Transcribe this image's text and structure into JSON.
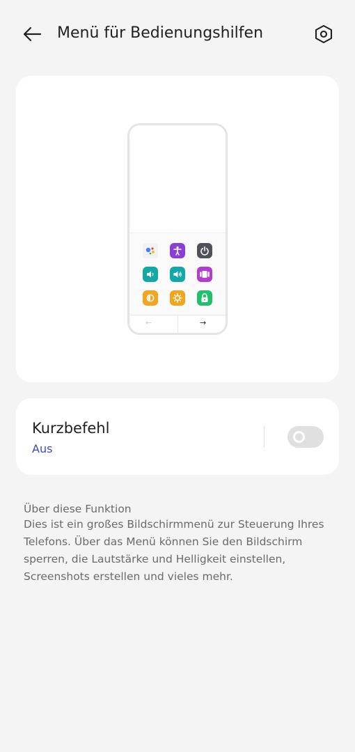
{
  "header": {
    "title": "Menü für Bedienungshilfen",
    "back_icon": "arrow-left-icon",
    "settings_icon": "gear-hexagon-icon"
  },
  "preview": {
    "tiles": [
      {
        "icon": "assistant-icon",
        "color": "#f1f2f4"
      },
      {
        "icon": "accessibility-icon",
        "color": "#8a3fd6"
      },
      {
        "icon": "power-icon",
        "color": "#505158"
      },
      {
        "icon": "volume-down-icon",
        "color": "#12a8a6"
      },
      {
        "icon": "volume-up-icon",
        "color": "#12a8a6"
      },
      {
        "icon": "recent-apps-icon",
        "color": "#b33bcf"
      },
      {
        "icon": "brightness-down-icon",
        "color": "#f2a51f"
      },
      {
        "icon": "brightness-up-icon",
        "color": "#f2a51f"
      },
      {
        "icon": "lock-icon",
        "color": "#22c06b"
      }
    ],
    "nav_back": "←",
    "nav_forward": "→"
  },
  "shortcut": {
    "title": "Kurzbefehl",
    "status": "Aus",
    "toggle_on": false,
    "status_color": "#3b4cc0"
  },
  "about": {
    "title": "Über diese Funktion",
    "body": "Dies ist ein großes Bildschirmmenü zur Steuerung Ihres Telefons. Über das Menü können Sie den Bildschirm sperren, die Lautstärke und Helligkeit einstellen, Screenshots erstellen und vieles mehr."
  }
}
